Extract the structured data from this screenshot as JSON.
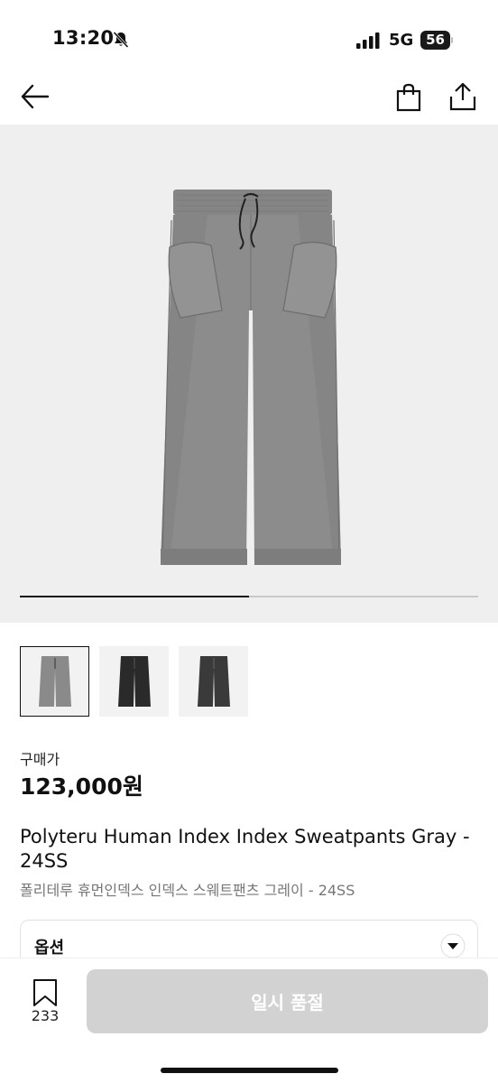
{
  "status": {
    "time": "13:20",
    "network": "5G",
    "battery": "56",
    "battery_level": 0.56
  },
  "nav": {
    "back_icon": "arrow-left-icon",
    "bag_icon": "shopping-bag-icon",
    "share_icon": "share-icon"
  },
  "gallery": {
    "progress": 0.5,
    "thumbnail_count": 3,
    "selected_thumbnail": 0
  },
  "product": {
    "price_label": "구매가",
    "price": "123,000원",
    "title_en": "Polyteru Human Index Index Sweatpants Gray - 24SS",
    "title_ko": "폴리테루 휴먼인덱스 인덱스 스웨트팬츠 그레이 - 24SS"
  },
  "option": {
    "label": "옵션"
  },
  "bottom": {
    "bookmark_count": "233",
    "action_label": "일시 품절"
  },
  "colors": {
    "background": "#ffffff",
    "gallery_bg": "#efefef",
    "disabled_button": "#d2d2d2",
    "pants_gray": "#8a8a8a",
    "pants_black": "#2a2a2a"
  }
}
